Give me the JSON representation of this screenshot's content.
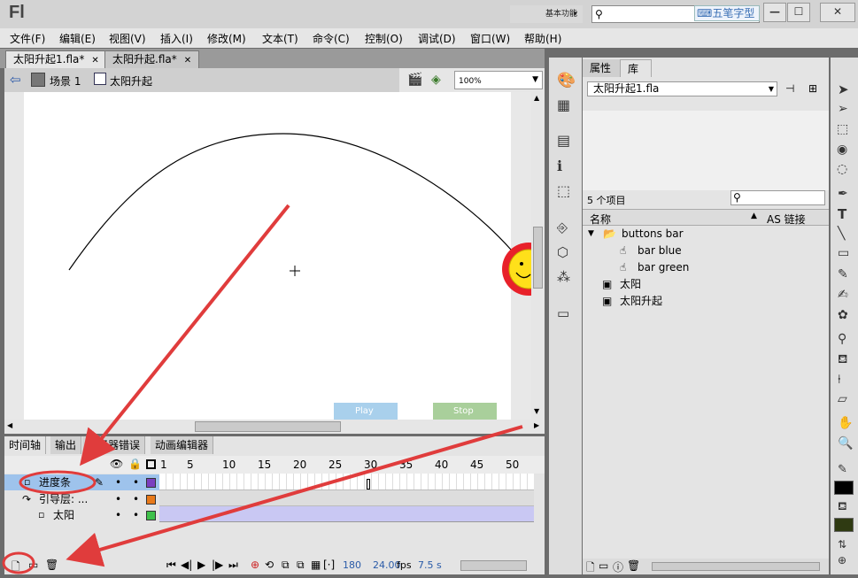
{
  "app": {
    "logo": "Fl",
    "workspace": "基本功能",
    "search_placeholder": "",
    "ime_label": "五笔字型"
  },
  "menu": [
    "文件(F)",
    "编辑(E)",
    "视图(V)",
    "插入(I)",
    "修改(M)",
    "文本(T)",
    "命令(C)",
    "控制(O)",
    "调试(D)",
    "窗口(W)",
    "帮助(H)"
  ],
  "doc_tabs": [
    {
      "label": "太阳升起1.fla*",
      "active": true
    },
    {
      "label": "太阳升起.fla*",
      "active": false
    }
  ],
  "editbar": {
    "scene": "场景 1",
    "symbol": "太阳升起",
    "zoom": "100%"
  },
  "stage_buttons": {
    "play": "Play",
    "stop": "Stop"
  },
  "panel_tabs": [
    "时间轴",
    "输出",
    "编译器错误",
    "动画编辑器"
  ],
  "timeline": {
    "frame_ticks": [
      "1",
      "5",
      "10",
      "15",
      "20",
      "25",
      "30",
      "35",
      "40",
      "45",
      "50"
    ],
    "layers": [
      {
        "name": "进度条",
        "selected": true,
        "color": "#7b3fbf"
      },
      {
        "name": "引导层: ...",
        "selected": false,
        "color": "#e87a1a"
      },
      {
        "name": "太阳",
        "selected": false,
        "color": "#3fc14a"
      }
    ],
    "current_frame": "180",
    "fps": "24.00",
    "fps_unit": "fps",
    "time": "7.5 s"
  },
  "library": {
    "tabs": [
      "属性",
      "库"
    ],
    "file": "太阳升起1.fla",
    "count": "5 个项目",
    "col_name": "名称",
    "col_link": "AS 链接",
    "items": [
      {
        "label": "buttons bar",
        "type": "folder",
        "indent": 0
      },
      {
        "label": "bar blue",
        "type": "button",
        "indent": 1
      },
      {
        "label": "bar green",
        "type": "button",
        "indent": 1
      },
      {
        "label": "太阳",
        "type": "graphic",
        "indent": 0
      },
      {
        "label": "太阳升起",
        "type": "movieclip",
        "indent": 0
      }
    ]
  },
  "colors": {
    "accent": "#5b8fd6",
    "arrow": "#e03c3c",
    "stroke": "#000000",
    "fill": "#2f3a12"
  }
}
